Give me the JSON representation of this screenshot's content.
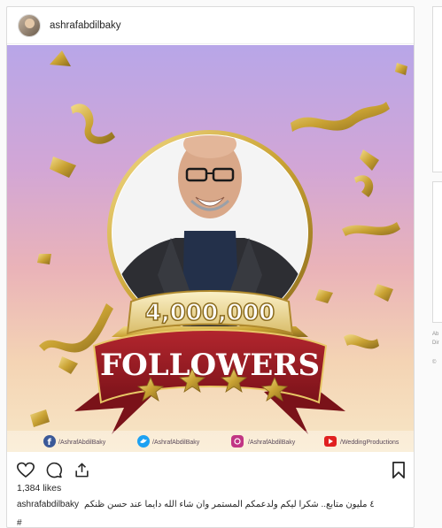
{
  "post": {
    "username": "ashrafabdilbaky",
    "likes": "1,384 likes",
    "caption_user": "ashrafabdilbaky",
    "caption_text": "٤ مليون متابع.. شكرا ليكم ولدعمكم المستمر وان شاء الله دايما عند حسن ظنكم",
    "cutoff_text": "#"
  },
  "artwork": {
    "count": "4,000,000",
    "banner": "FOLLOWERS",
    "socials": [
      {
        "icon": "facebook-icon",
        "handle": "/AshrafAbdilBaky",
        "color": "#3b5998"
      },
      {
        "icon": "twitter-icon",
        "handle": "/AshrafAbdilBaky",
        "color": "#1da1f2"
      },
      {
        "icon": "instagram-icon",
        "handle": "/AshrafAbdilBaky",
        "color": "#c13584"
      },
      {
        "icon": "youtube-icon",
        "handle": "/WeddingProductions",
        "color": "#e02020"
      }
    ]
  },
  "sidebar": {
    "fragments": [
      "Ab",
      "Dir",
      "© "
    ]
  },
  "colors": {
    "banner_red": "#9b1c24",
    "gold": "#c9a233"
  }
}
